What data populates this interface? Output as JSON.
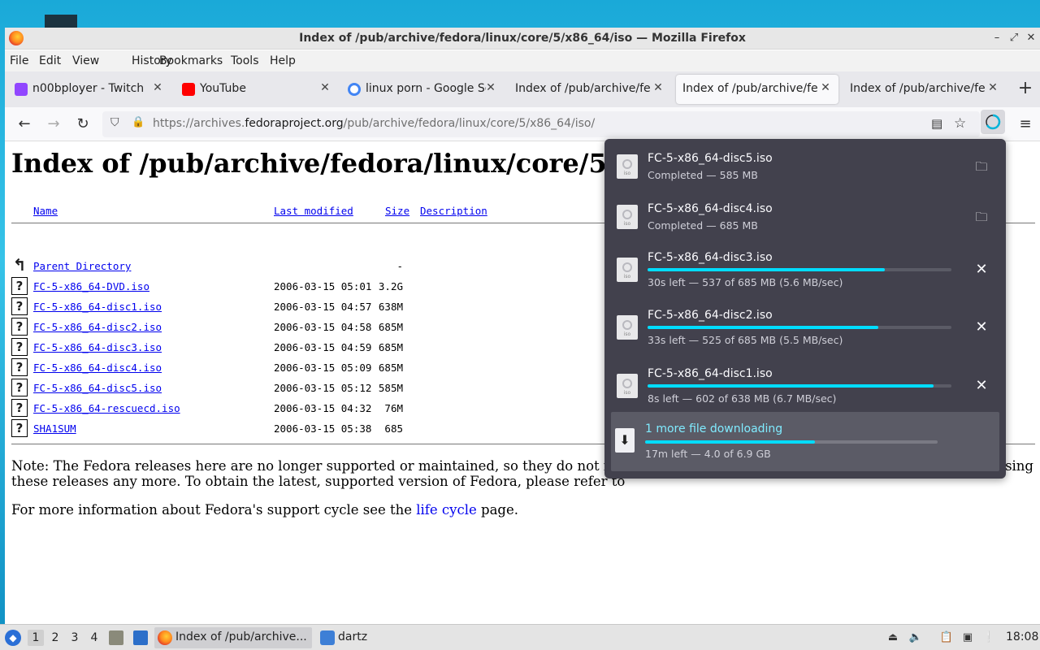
{
  "window": {
    "title": "Index of /pub/archive/fedora/linux/core/5/x86_64/iso — Mozilla Firefox",
    "controls": {
      "minimize": "–",
      "maximize": "⤢",
      "close": "✕"
    }
  },
  "menu": [
    "File",
    "Edit",
    "View",
    "History",
    "Bookmarks",
    "Tools",
    "Help"
  ],
  "tabs": [
    {
      "label": "n00bployer - Twitch",
      "icon": "twitch-icon",
      "color": "#9146ff",
      "active": false
    },
    {
      "label": "YouTube",
      "icon": "youtube-icon",
      "color": "#ff0000",
      "active": false
    },
    {
      "label": "linux porn - Google Se",
      "icon": "google-icon",
      "color": "#4285f4",
      "active": false
    },
    {
      "label": "Index of /pub/archive/fed",
      "icon": "",
      "color": "",
      "active": false
    },
    {
      "label": "Index of /pub/archive/fed",
      "icon": "",
      "color": "",
      "active": true
    },
    {
      "label": "Index of /pub/archive/fed",
      "icon": "",
      "color": "",
      "active": false
    }
  ],
  "url": {
    "prefix": "https://archives.",
    "domain": "fedoraproject.org",
    "path": "/pub/archive/fedora/linux/core/5/x86_64/iso/"
  },
  "page": {
    "heading": "Index of /pub/archive/fedora/linux/core/5",
    "columns": {
      "name": "Name",
      "modified": "Last modified",
      "size": "Size",
      "description": "Description"
    },
    "rows": [
      {
        "name": "Parent Directory",
        "date": "",
        "size": "-",
        "icon": "back"
      },
      {
        "name": "FC-5-x86_64-DVD.iso",
        "date": "2006-03-15 05:01",
        "size": "3.2G",
        "icon": "?"
      },
      {
        "name": "FC-5-x86_64-disc1.iso",
        "date": "2006-03-15 04:57",
        "size": "638M",
        "icon": "?"
      },
      {
        "name": "FC-5-x86_64-disc2.iso",
        "date": "2006-03-15 04:58",
        "size": "685M",
        "icon": "?"
      },
      {
        "name": "FC-5-x86_64-disc3.iso",
        "date": "2006-03-15 04:59",
        "size": "685M",
        "icon": "?"
      },
      {
        "name": "FC-5-x86_64-disc4.iso",
        "date": "2006-03-15 05:09",
        "size": "685M",
        "icon": "?"
      },
      {
        "name": "FC-5-x86_64-disc5.iso",
        "date": "2006-03-15 05:12",
        "size": "585M",
        "icon": "?"
      },
      {
        "name": "FC-5-x86_64-rescuecd.iso",
        "date": "2006-03-15 04:32",
        "size": "76M",
        "icon": "?"
      },
      {
        "name": "SHA1SUM",
        "date": "2006-03-15 05:38",
        "size": "685",
        "icon": "?"
      }
    ],
    "note_line1": "Note: The Fedora releases here are no longer supported or maintained, so they do not rec",
    "note_line1_end": "sing",
    "note_line2": "these releases any more. To obtain the latest, supported version of Fedora, please refer to",
    "info_prefix": "For more information about Fedora's support cycle see the ",
    "info_link": "life cycle",
    "info_suffix": " page."
  },
  "downloads": {
    "items": [
      {
        "name": "FC-5-x86_64-disc5.iso",
        "status": "Completed — 585 MB",
        "progress": null,
        "action": "folder-icon"
      },
      {
        "name": "FC-5-x86_64-disc4.iso",
        "status": "Completed — 685 MB",
        "progress": null,
        "action": "folder-icon"
      },
      {
        "name": "FC-5-x86_64-disc3.iso",
        "status": "30s left — 537 of 685 MB (5.6 MB/sec)",
        "progress": 0.78,
        "action": "cancel-icon"
      },
      {
        "name": "FC-5-x86_64-disc2.iso",
        "status": "33s left — 525 of 685 MB (5.5 MB/sec)",
        "progress": 0.76,
        "action": "cancel-icon"
      },
      {
        "name": "FC-5-x86_64-disc1.iso",
        "status": "8s left — 602 of 638 MB (6.7 MB/sec)",
        "progress": 0.94,
        "action": "cancel-icon"
      }
    ],
    "file_icon_label": "iso",
    "more": {
      "label": "1 more file downloading",
      "status": "17m left — 4.0 of 6.9 GB",
      "progress": 0.58
    }
  },
  "taskbar": {
    "workspaces": [
      "1",
      "2",
      "3",
      "4"
    ],
    "active_workspace": "1",
    "tasks": [
      {
        "label": "Index of /pub/archive...",
        "icon": "firefox-icon",
        "active": true
      },
      {
        "label": "dartz",
        "icon": "folder-icon",
        "active": false
      }
    ],
    "clock": "18:08"
  },
  "colors": {
    "accent": "#00ddff",
    "panel": "#42414d",
    "link": "#0000ee"
  }
}
